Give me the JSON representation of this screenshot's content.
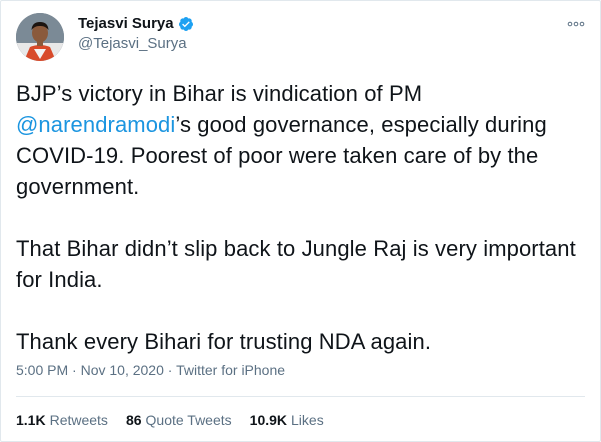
{
  "author": {
    "display_name": "Tejasvi Surya",
    "handle": "@Tejasvi_Surya",
    "avatar_icon": "profile-photo",
    "verified_icon": "verified-badge-icon",
    "verified_color": "#1da1f2"
  },
  "more_icon": "more-dots-icon",
  "tweet": {
    "p1_before": "BJP’s victory in Bihar is vindication of PM ",
    "mention": "@narendramodi",
    "p1_after": "’s good governance, especially during COVID-19. Poorest of poor were taken care of by the government.",
    "p2": "That Bihar didn’t slip back to Jungle Raj is very important for India.",
    "p3": "Thank every Bihari for trusting NDA again."
  },
  "meta": {
    "time": "5:00 PM",
    "separator": " · ",
    "date": "Nov 10, 2020",
    "source": "Twitter for iPhone"
  },
  "stats": {
    "retweets_count": "1.1K",
    "retweets_label": "Retweets",
    "quotes_count": "86",
    "quotes_label": "Quote Tweets",
    "likes_count": "10.9K",
    "likes_label": "Likes"
  },
  "colors": {
    "text": "#0f1419",
    "secondary": "#5b7083",
    "link": "#1b95e0",
    "border": "#e1e8ed"
  }
}
